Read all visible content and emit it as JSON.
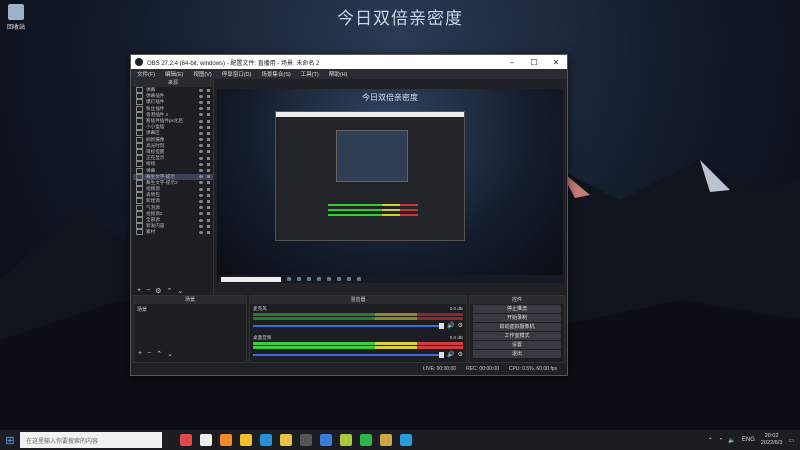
{
  "desktop": {
    "title": "今日双倍亲密度",
    "recycle_label": "回收站"
  },
  "window": {
    "title": "OBS 27.2.4 (64-bit, windows) - 配置文件: 直播用 - 场景: 未命名 2",
    "menus": [
      "文件(F)",
      "编辑(E)",
      "视图(V)",
      "停靠窗口(D)",
      "场景集合(S)",
      "工具(T)",
      "帮助(H)"
    ]
  },
  "sources": {
    "header": "来源",
    "items": [
      "弹幕",
      "弹幕插件",
      "爆灯插件",
      "粉丝插件",
      "香港插件 2",
      "看插件插件ps化后",
      "小小盒插",
      "弹幕区",
      "刷新摄像",
      "高光时刻",
      "目标提醒",
      "正在显示",
      "榜榜",
      "弹幕",
      "舞生文字-提示",
      "舞生文字-提示2",
      "视频源",
      "表情包",
      "新建源",
      "气泡源",
      "视频源2",
      "全部源",
      "新发内容",
      "素材"
    ],
    "highlighted_index": 14
  },
  "preview": {
    "overlay_title": "今日双倍亲密度"
  },
  "scenes": {
    "header": "场景",
    "items": [
      "场景"
    ]
  },
  "mixer": {
    "header": "混音器",
    "channels": [
      {
        "name": "麦克风",
        "db": "0.0 dB"
      },
      {
        "name": "桌面音频",
        "db": "0.0 dB"
      }
    ]
  },
  "controls": {
    "header": "控件",
    "buttons": [
      "停止推流",
      "开始录制",
      "启动虚拟摄像机",
      "工作室模式",
      "设置",
      "退出"
    ]
  },
  "status": {
    "live": "LIVE: 00:00:00",
    "rec": "REC: 00:00:00",
    "cpu": "CPU: 0.5%, 60.00 fps"
  },
  "taskbar": {
    "search_placeholder": "在这里输入你要搜索的内容",
    "lang": "ENG",
    "time": "20:02",
    "date": "2022/6/3"
  }
}
